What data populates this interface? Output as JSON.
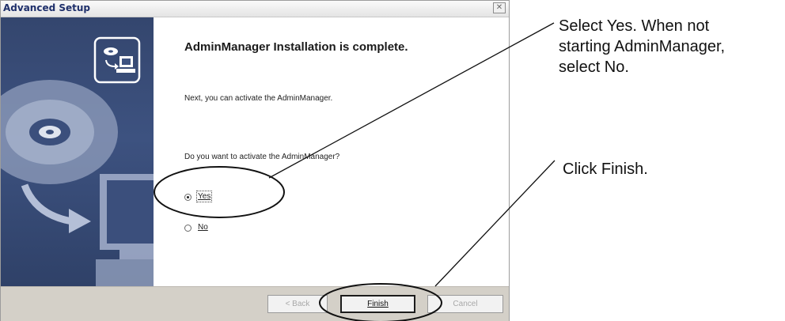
{
  "window": {
    "title": "Advanced Setup",
    "close_glyph": "✕"
  },
  "content": {
    "heading": "AdminManager Installation is complete.",
    "line1": "Next, you can activate the AdminManager.",
    "question": "Do you want to activate the AdminManager?",
    "options": [
      {
        "label": "Yes",
        "selected": true
      },
      {
        "label": "No",
        "selected": false
      }
    ]
  },
  "buttons": {
    "back": "< Back",
    "finish": "Finish",
    "cancel": "Cancel"
  },
  "annotations": {
    "select_yes": [
      "Select Yes.  When not",
      "starting AdminManager,",
      "select No."
    ],
    "click_finish": "Click Finish."
  },
  "icons": [
    "setup-computer-icon",
    "cd-icon",
    "arrow-icon",
    "monitor-icon",
    "close-icon"
  ],
  "colors": {
    "side_panel": "#3a4d79",
    "bottom_bar": "#d4d0c8",
    "title_text": "#1e2f6a"
  }
}
